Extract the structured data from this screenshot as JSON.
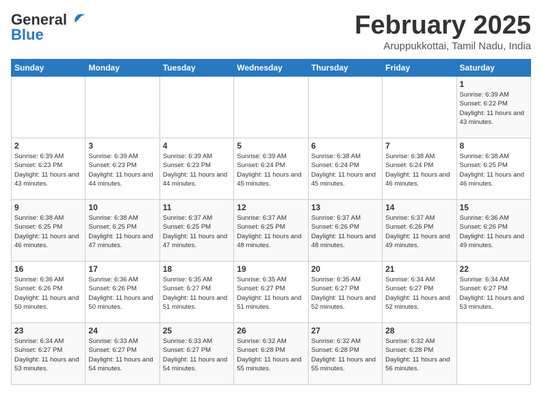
{
  "header": {
    "logo_general": "General",
    "logo_blue": "Blue",
    "title": "February 2025",
    "subtitle": "Aruppukkottai, Tamil Nadu, India"
  },
  "weekdays": [
    "Sunday",
    "Monday",
    "Tuesday",
    "Wednesday",
    "Thursday",
    "Friday",
    "Saturday"
  ],
  "weeks": [
    [
      {
        "day": "",
        "sunrise": "",
        "sunset": "",
        "daylight": ""
      },
      {
        "day": "",
        "sunrise": "",
        "sunset": "",
        "daylight": ""
      },
      {
        "day": "",
        "sunrise": "",
        "sunset": "",
        "daylight": ""
      },
      {
        "day": "",
        "sunrise": "",
        "sunset": "",
        "daylight": ""
      },
      {
        "day": "",
        "sunrise": "",
        "sunset": "",
        "daylight": ""
      },
      {
        "day": "",
        "sunrise": "",
        "sunset": "",
        "daylight": ""
      },
      {
        "day": "1",
        "sunrise": "6:39 AM",
        "sunset": "6:22 PM",
        "daylight": "11 hours and 43 minutes."
      }
    ],
    [
      {
        "day": "2",
        "sunrise": "6:39 AM",
        "sunset": "6:23 PM",
        "daylight": "11 hours and 43 minutes."
      },
      {
        "day": "3",
        "sunrise": "6:39 AM",
        "sunset": "6:23 PM",
        "daylight": "11 hours and 44 minutes."
      },
      {
        "day": "4",
        "sunrise": "6:39 AM",
        "sunset": "6:23 PM",
        "daylight": "11 hours and 44 minutes."
      },
      {
        "day": "5",
        "sunrise": "6:39 AM",
        "sunset": "6:24 PM",
        "daylight": "11 hours and 45 minutes."
      },
      {
        "day": "6",
        "sunrise": "6:38 AM",
        "sunset": "6:24 PM",
        "daylight": "11 hours and 45 minutes."
      },
      {
        "day": "7",
        "sunrise": "6:38 AM",
        "sunset": "6:24 PM",
        "daylight": "11 hours and 46 minutes."
      },
      {
        "day": "8",
        "sunrise": "6:38 AM",
        "sunset": "6:25 PM",
        "daylight": "11 hours and 46 minutes."
      }
    ],
    [
      {
        "day": "9",
        "sunrise": "6:38 AM",
        "sunset": "6:25 PM",
        "daylight": "11 hours and 46 minutes."
      },
      {
        "day": "10",
        "sunrise": "6:38 AM",
        "sunset": "6:25 PM",
        "daylight": "11 hours and 47 minutes."
      },
      {
        "day": "11",
        "sunrise": "6:37 AM",
        "sunset": "6:25 PM",
        "daylight": "11 hours and 47 minutes."
      },
      {
        "day": "12",
        "sunrise": "6:37 AM",
        "sunset": "6:25 PM",
        "daylight": "11 hours and 48 minutes."
      },
      {
        "day": "13",
        "sunrise": "6:37 AM",
        "sunset": "6:26 PM",
        "daylight": "11 hours and 48 minutes."
      },
      {
        "day": "14",
        "sunrise": "6:37 AM",
        "sunset": "6:26 PM",
        "daylight": "11 hours and 49 minutes."
      },
      {
        "day": "15",
        "sunrise": "6:36 AM",
        "sunset": "6:26 PM",
        "daylight": "11 hours and 49 minutes."
      }
    ],
    [
      {
        "day": "16",
        "sunrise": "6:36 AM",
        "sunset": "6:26 PM",
        "daylight": "11 hours and 50 minutes."
      },
      {
        "day": "17",
        "sunrise": "6:36 AM",
        "sunset": "6:26 PM",
        "daylight": "11 hours and 50 minutes."
      },
      {
        "day": "18",
        "sunrise": "6:35 AM",
        "sunset": "6:27 PM",
        "daylight": "11 hours and 51 minutes."
      },
      {
        "day": "19",
        "sunrise": "6:35 AM",
        "sunset": "6:27 PM",
        "daylight": "11 hours and 51 minutes."
      },
      {
        "day": "20",
        "sunrise": "6:35 AM",
        "sunset": "6:27 PM",
        "daylight": "11 hours and 52 minutes."
      },
      {
        "day": "21",
        "sunrise": "6:34 AM",
        "sunset": "6:27 PM",
        "daylight": "11 hours and 52 minutes."
      },
      {
        "day": "22",
        "sunrise": "6:34 AM",
        "sunset": "6:27 PM",
        "daylight": "11 hours and 53 minutes."
      }
    ],
    [
      {
        "day": "23",
        "sunrise": "6:34 AM",
        "sunset": "6:27 PM",
        "daylight": "11 hours and 53 minutes."
      },
      {
        "day": "24",
        "sunrise": "6:33 AM",
        "sunset": "6:27 PM",
        "daylight": "11 hours and 54 minutes."
      },
      {
        "day": "25",
        "sunrise": "6:33 AM",
        "sunset": "6:27 PM",
        "daylight": "11 hours and 54 minutes."
      },
      {
        "day": "26",
        "sunrise": "6:32 AM",
        "sunset": "6:28 PM",
        "daylight": "11 hours and 55 minutes."
      },
      {
        "day": "27",
        "sunrise": "6:32 AM",
        "sunset": "6:28 PM",
        "daylight": "11 hours and 55 minutes."
      },
      {
        "day": "28",
        "sunrise": "6:32 AM",
        "sunset": "6:28 PM",
        "daylight": "11 hours and 56 minutes."
      },
      {
        "day": "",
        "sunrise": "",
        "sunset": "",
        "daylight": ""
      }
    ]
  ]
}
